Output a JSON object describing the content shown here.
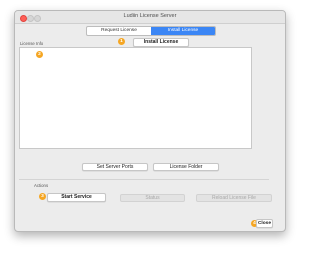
{
  "window": {
    "title": "Ludiin License Server"
  },
  "tabs": [
    {
      "label": "Request License",
      "active": false
    },
    {
      "label": "Install License",
      "active": true
    }
  ],
  "install": {
    "badge": "1",
    "button_label": "Install License"
  },
  "license_info": {
    "section_label": "License Info",
    "badge": "2",
    "buttons": {
      "set_server_ports": "Set Server Ports",
      "license_folder": "License Folder"
    }
  },
  "actions": {
    "section_label": "Actions",
    "badge": "3",
    "start_service": "Start Service",
    "status": "Status",
    "reload_license_file": "Reload License File"
  },
  "footer": {
    "badge": "4",
    "close_label": "Close"
  },
  "colors": {
    "accent": "#3b86f5",
    "badge": "#f5a623",
    "close_dot": "#ff5f57"
  }
}
